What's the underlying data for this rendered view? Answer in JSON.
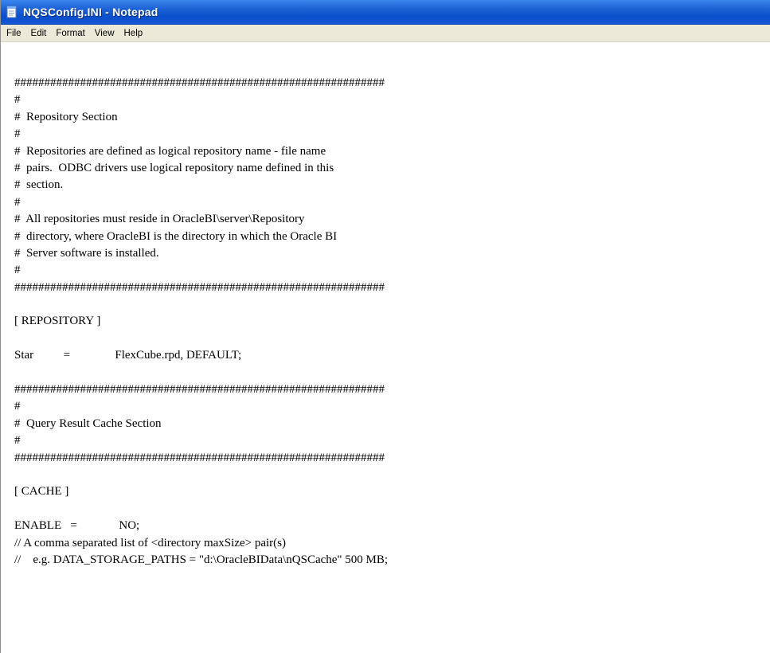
{
  "window": {
    "title": "NQSConfig.INI - Notepad",
    "icon": "notepad-icon"
  },
  "menu": {
    "items": [
      "File",
      "Edit",
      "Format",
      "View",
      "Help"
    ]
  },
  "editor": {
    "lines": [
      "##############################################################",
      "#",
      "#  Repository Section",
      "#",
      "#  Repositories are defined as logical repository name - file name",
      "#  pairs.  ODBC drivers use logical repository name defined in this",
      "#  section.",
      "#",
      "#  All repositories must reside in OracleBI\\server\\Repository",
      "#  directory, where OracleBI is the directory in which the Oracle BI",
      "#  Server software is installed.",
      "#",
      "##############################################################",
      "",
      "[ REPOSITORY ]",
      "",
      "Star          =               FlexCube.rpd, DEFAULT;",
      "",
      "##############################################################",
      "#",
      "#  Query Result Cache Section",
      "#",
      "##############################################################",
      "",
      "[ CACHE ]",
      "",
      "ENABLE   =              NO;",
      "// A comma separated list of <directory maxSize> pair(s)",
      "//    e.g. DATA_STORAGE_PATHS = \"d:\\OracleBIData\\nQSCache\" 500 MB;"
    ]
  }
}
